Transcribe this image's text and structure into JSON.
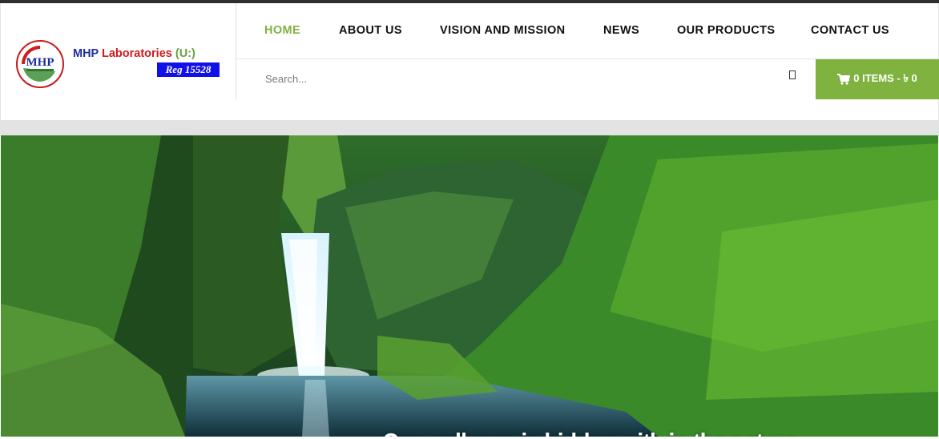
{
  "brand": {
    "abbr": "MHP",
    "name_part1": "MHP",
    "name_part2": "Laboratories",
    "name_part3": "(U:)",
    "reg": "Reg 15528"
  },
  "nav": {
    "items": [
      {
        "label": "HOME",
        "active": true
      },
      {
        "label": "ABOUT US",
        "active": false
      },
      {
        "label": "VISION AND MISSION",
        "active": false
      },
      {
        "label": "NEWS",
        "active": false
      },
      {
        "label": "OUR PRODUCTS",
        "active": false
      },
      {
        "label": "CONTACT US",
        "active": false
      }
    ]
  },
  "search": {
    "placeholder": "Search..."
  },
  "cart": {
    "label": "0 ITEMS - ৳ 0",
    "icon": "shopping-cart-icon"
  },
  "hero": {
    "caption": "Our wellness is hidden with in the nature"
  },
  "colors": {
    "accent": "#7fb23f",
    "nav_text": "#111111",
    "topline": "#2f2f2f"
  }
}
